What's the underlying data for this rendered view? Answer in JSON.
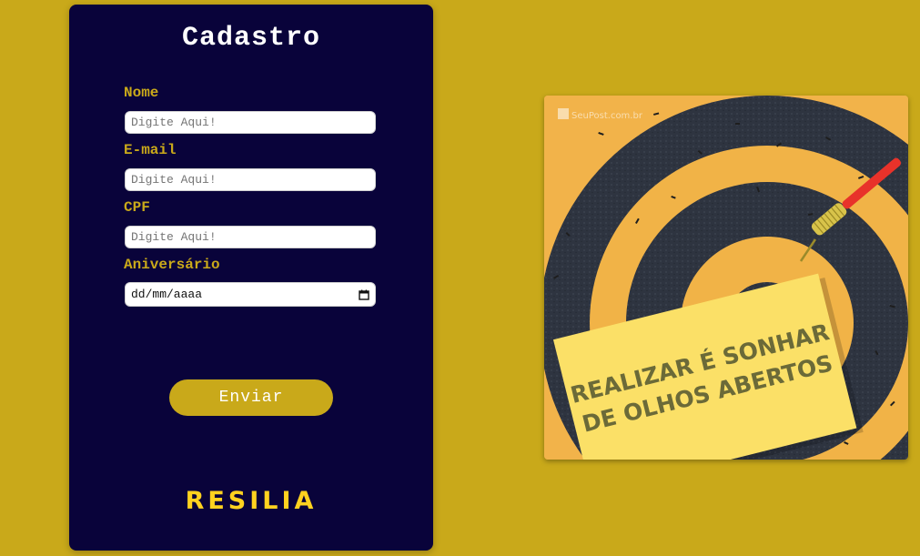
{
  "form": {
    "title": "Cadastro",
    "fields": [
      {
        "label": "Nome",
        "placeholder": "Digite Aqui!"
      },
      {
        "label": "E-mail",
        "placeholder": "Digite Aqui!"
      },
      {
        "label": "CPF",
        "placeholder": "Digite Aqui!"
      },
      {
        "label": "Aniversário",
        "placeholder": "dd/mm/aaaa"
      }
    ],
    "submit_label": "Enviar",
    "brand": "RESILIA"
  },
  "image": {
    "watermark": "SeuPost.com.br",
    "note_line1": "REALIZAR É SONHAR",
    "note_line2": "DE OLHOS ABERTOS"
  },
  "colors": {
    "background": "#c9a91a",
    "card": "#09033a",
    "accent": "#c9a91a",
    "brand": "#ffd21f"
  }
}
